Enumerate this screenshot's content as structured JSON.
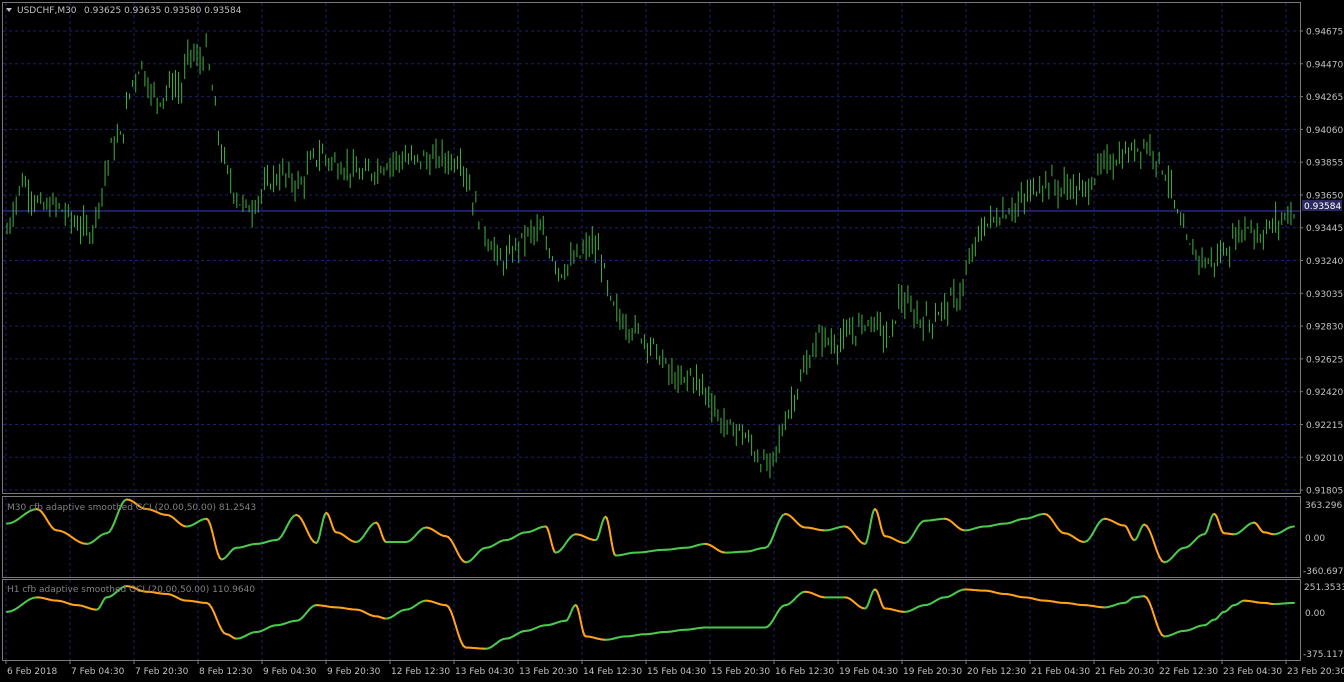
{
  "header": {
    "symbol_label": "USDCHF,M30",
    "ohlc": "0.93625 0.93635 0.93580 0.93584"
  },
  "price_panel": {
    "current_price": "0.93584",
    "colors": {
      "background": "#000000",
      "candle": "#3fb23f",
      "grid": "#1e1e6e",
      "price_line": "#3c3cc8"
    }
  },
  "indicator1": {
    "title": "M30 cfb adaptive smoothed GCI (20.00,50.00) 81.2543",
    "axis_labels": [
      "363.296",
      "0.00",
      "-360.6973"
    ]
  },
  "indicator2": {
    "title": "H1 cfb adaptive smoothed GCI (20.00,50.00) 110.9640",
    "axis_labels": [
      "251.3533",
      "0.00",
      "-375.117"
    ]
  },
  "colors": {
    "up": "#4cc94c",
    "down": "#ffa31a"
  },
  "chart_data": [
    {
      "type": "candlestick",
      "symbol": "USDCHF,M30",
      "ylim": [
        0.918,
        0.9474
      ],
      "y_ticks": [
        "0.94675",
        "0.94470",
        "0.94265",
        "0.94060",
        "0.93855",
        "0.93650",
        "0.93445",
        "0.93240",
        "0.93035",
        "0.92830",
        "0.92625",
        "0.92420",
        "0.92215",
        "0.92010",
        "0.91805"
      ],
      "x_ticks": [
        "6 Feb 2018",
        "7 Feb 04:30",
        "7 Feb 20:30",
        "8 Feb 12:30",
        "9 Feb 04:30",
        "9 Feb 20:30",
        "12 Feb 12:30",
        "13 Feb 04:30",
        "13 Feb 20:30",
        "14 Feb 12:30",
        "15 Feb 04:30",
        "15 Feb 20:30",
        "16 Feb 12:30",
        "19 Feb 04:30",
        "19 Feb 20:30",
        "20 Feb 12:30",
        "21 Feb 04:30",
        "21 Feb 20:30",
        "22 Feb 12:30",
        "23 Feb 04:30",
        "23 Feb 20:30"
      ],
      "close_path": [
        [
          0,
          0.9345
        ],
        [
          1.5,
          0.9378
        ],
        [
          3.5,
          0.936
        ],
        [
          5,
          0.9362
        ],
        [
          7,
          0.935
        ],
        [
          8.5,
          0.9345
        ],
        [
          9.5,
          0.9372
        ],
        [
          10.5,
          0.94
        ],
        [
          11.5,
          0.9405
        ],
        [
          12.5,
          0.944
        ],
        [
          13.5,
          0.9452
        ],
        [
          14.5,
          0.9432
        ],
        [
          15.5,
          0.943
        ],
        [
          16.5,
          0.944
        ],
        [
          17.5,
          0.9435
        ],
        [
          18.3,
          0.9462
        ],
        [
          19.2,
          0.9452
        ],
        [
          20,
          0.946
        ],
        [
          21.5,
          0.9395
        ],
        [
          22.5,
          0.9375
        ],
        [
          23.5,
          0.9362
        ],
        [
          24.5,
          0.936
        ],
        [
          25.5,
          0.937
        ],
        [
          26.5,
          0.9378
        ],
        [
          27.5,
          0.9382
        ],
        [
          28.5,
          0.9378
        ],
        [
          29.5,
          0.9375
        ],
        [
          30.5,
          0.939
        ],
        [
          31.5,
          0.9395
        ],
        [
          32.5,
          0.939
        ],
        [
          33.5,
          0.9387
        ],
        [
          34.5,
          0.9385
        ],
        [
          35.5,
          0.938
        ],
        [
          36.5,
          0.9383
        ],
        [
          37.5,
          0.9387
        ],
        [
          38.5,
          0.939
        ],
        [
          39.5,
          0.9392
        ],
        [
          40.5,
          0.939
        ],
        [
          41.5,
          0.9392
        ],
        [
          42.5,
          0.939
        ],
        [
          43.5,
          0.9393
        ],
        [
          44.5,
          0.939
        ],
        [
          45.5,
          0.9392
        ],
        [
          47.5,
          0.935
        ],
        [
          48.5,
          0.9338
        ],
        [
          49.5,
          0.9325
        ],
        [
          50.5,
          0.933
        ],
        [
          51.5,
          0.934
        ],
        [
          52.5,
          0.9345
        ],
        [
          53.5,
          0.9345
        ],
        [
          55.5,
          0.932
        ],
        [
          56.5,
          0.9325
        ],
        [
          57.5,
          0.933
        ],
        [
          58.5,
          0.9338
        ],
        [
          59.5,
          0.933
        ],
        [
          60.5,
          0.93
        ],
        [
          61.5,
          0.929
        ],
        [
          62.5,
          0.9285
        ],
        [
          63.5,
          0.928
        ],
        [
          64.5,
          0.9275
        ],
        [
          65.5,
          0.9265
        ],
        [
          66.5,
          0.9255
        ],
        [
          67.5,
          0.9248
        ],
        [
          68.5,
          0.9255
        ],
        [
          69.5,
          0.9248
        ],
        [
          70.5,
          0.924
        ],
        [
          71.5,
          0.9225
        ],
        [
          72.5,
          0.922
        ],
        [
          73.5,
          0.922
        ],
        [
          74.5,
          0.921
        ],
        [
          75.5,
          0.92
        ],
        [
          76.5,
          0.9195
        ],
        [
          77.5,
          0.9215
        ],
        [
          78.5,
          0.9235
        ],
        [
          79.5,
          0.925
        ],
        [
          80.5,
          0.9265
        ],
        [
          81.5,
          0.928
        ],
        [
          82.5,
          0.9275
        ],
        [
          83.5,
          0.9275
        ],
        [
          84.5,
          0.928
        ],
        [
          85.5,
          0.9285
        ],
        [
          86.5,
          0.929
        ],
        [
          87.5,
          0.9285
        ],
        [
          88.5,
          0.9275
        ],
        [
          89.5,
          0.9305
        ],
        [
          90.5,
          0.9295
        ],
        [
          91.5,
          0.929
        ],
        [
          92.5,
          0.9288
        ],
        [
          93.5,
          0.9295
        ],
        [
          94.5,
          0.93
        ],
        [
          95.5,
          0.9305
        ],
        [
          96.5,
          0.9325
        ],
        [
          97.5,
          0.9345
        ],
        [
          98.5,
          0.9352
        ],
        [
          99.5,
          0.9355
        ],
        [
          100.5,
          0.936
        ],
        [
          101.5,
          0.9362
        ],
        [
          102.5,
          0.937
        ],
        [
          103.5,
          0.9375
        ],
        [
          104.5,
          0.9378
        ],
        [
          105.5,
          0.9372
        ],
        [
          106.5,
          0.9375
        ],
        [
          107.5,
          0.937
        ],
        [
          108.5,
          0.9375
        ],
        [
          109.5,
          0.9385
        ],
        [
          110.5,
          0.939
        ],
        [
          111.5,
          0.9392
        ],
        [
          112.5,
          0.9395
        ],
        [
          113.5,
          0.94
        ],
        [
          114.5,
          0.94
        ],
        [
          115.5,
          0.939
        ],
        [
          116.5,
          0.9378
        ],
        [
          117.5,
          0.935
        ],
        [
          118.5,
          0.9335
        ],
        [
          119.5,
          0.933
        ],
        [
          120.5,
          0.9325
        ],
        [
          121.5,
          0.933
        ],
        [
          122.5,
          0.9335
        ],
        [
          123.5,
          0.9345
        ],
        [
          124.5,
          0.935
        ],
        [
          125.5,
          0.9342
        ],
        [
          126.5,
          0.9348
        ],
        [
          127.5,
          0.9352
        ],
        [
          128.5,
          0.9358
        ],
        [
          129,
          0.9358
        ]
      ]
    },
    {
      "type": "line",
      "name": "M30 cfb adaptive smoothed GCI",
      "ylim": [
        -360.6973,
        363.296
      ],
      "x_index": [
        0,
        3,
        5,
        8,
        10,
        12,
        14,
        16,
        18,
        20,
        21.5,
        23,
        25,
        27,
        29,
        31,
        32,
        33,
        35,
        37,
        38,
        40,
        42,
        44,
        46,
        48,
        50,
        52,
        54,
        55,
        57,
        59,
        60,
        61,
        63,
        66,
        68,
        70,
        72,
        74,
        76,
        78,
        80,
        82,
        84,
        86,
        87,
        88,
        90,
        92,
        94,
        96,
        98,
        100,
        102,
        104,
        106,
        108,
        110,
        112,
        113,
        114,
        116,
        118,
        120,
        121,
        122,
        123,
        125,
        126,
        127,
        129
      ],
      "values": [
        150,
        300,
        80,
        -60,
        50,
        400,
        300,
        240,
        120,
        200,
        -220,
        -100,
        -60,
        -20,
        240,
        -50,
        260,
        60,
        -40,
        160,
        -40,
        -40,
        110,
        20,
        -250,
        -100,
        -20,
        60,
        120,
        -150,
        40,
        -20,
        220,
        -180,
        -150,
        -120,
        -100,
        -60,
        -150,
        -140,
        -100,
        250,
        110,
        80,
        120,
        -60,
        300,
        20,
        -50,
        180,
        200,
        80,
        120,
        150,
        200,
        250,
        50,
        -40,
        200,
        130,
        -20,
        140,
        -250,
        -100,
        40,
        250,
        50,
        40,
        160,
        60,
        40,
        120
      ]
    },
    {
      "type": "line",
      "name": "H1 cfb adaptive smoothed GCI",
      "ylim": [
        -375.117,
        251.3533
      ],
      "x_index": [
        0,
        3,
        5,
        7,
        9,
        10,
        12,
        14,
        16,
        18,
        20,
        22,
        23,
        25,
        27,
        29,
        31,
        33,
        35,
        37,
        38,
        40,
        42,
        44,
        46,
        48,
        50,
        52,
        54,
        56,
        57,
        58,
        60,
        62,
        64,
        66,
        68,
        70,
        72,
        74,
        76,
        78,
        80,
        82,
        84,
        86,
        87,
        88,
        90,
        92,
        94,
        96,
        98,
        100,
        102,
        104,
        106,
        108,
        110,
        112,
        113,
        114,
        116,
        118,
        120,
        121,
        122,
        123,
        124,
        126,
        127,
        129
      ],
      "values": [
        20,
        150,
        120,
        80,
        40,
        150,
        250,
        200,
        180,
        120,
        100,
        -180,
        -220,
        -160,
        -100,
        -60,
        80,
        60,
        40,
        -20,
        -40,
        40,
        120,
        80,
        -300,
        -310,
        -220,
        -150,
        -100,
        -60,
        80,
        -200,
        -230,
        -200,
        -180,
        -160,
        -140,
        -120,
        -120,
        -120,
        -120,
        80,
        200,
        150,
        150,
        50,
        220,
        50,
        20,
        80,
        150,
        220,
        210,
        180,
        150,
        120,
        100,
        80,
        60,
        100,
        150,
        160,
        -200,
        -150,
        -100,
        -50,
        20,
        80,
        120,
        100,
        90,
        100
      ]
    }
  ]
}
